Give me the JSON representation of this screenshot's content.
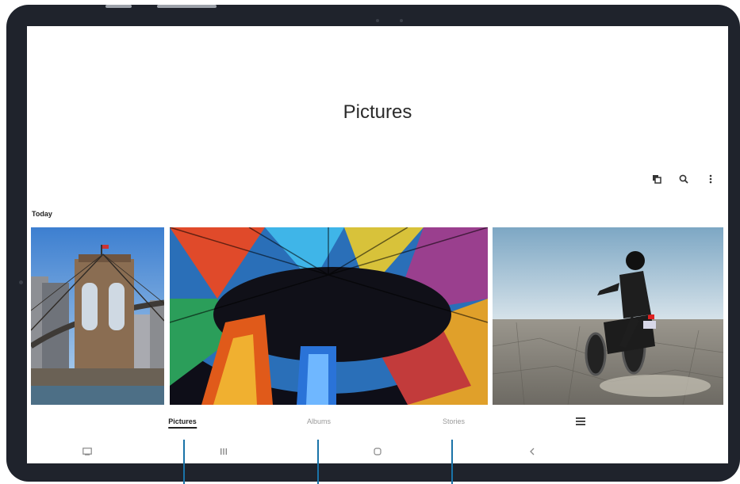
{
  "screen": {
    "title": "Pictures",
    "toolbar": [
      {
        "name": "select-icon"
      },
      {
        "name": "search-icon"
      },
      {
        "name": "more-options-icon"
      }
    ],
    "section_label": "Today",
    "photos": [
      {
        "name": "brooklyn-bridge-photo"
      },
      {
        "name": "stained-glass-dome-photo"
      },
      {
        "name": "motorcycle-desert-photo"
      }
    ],
    "tabs": [
      {
        "label": "Pictures",
        "active": true
      },
      {
        "label": "Albums",
        "active": false
      },
      {
        "label": "Stories",
        "active": false
      },
      {
        "label": "menu-icon",
        "active": false
      }
    ],
    "navbar": [
      {
        "name": "screenshot-icon"
      },
      {
        "name": "recents-icon"
      },
      {
        "name": "home-icon"
      },
      {
        "name": "back-icon"
      }
    ]
  },
  "colors": {
    "bezel": "#1f232c",
    "callout": "#1a73a8",
    "text": "#222222",
    "inactive_tab": "#9a9a9a"
  }
}
